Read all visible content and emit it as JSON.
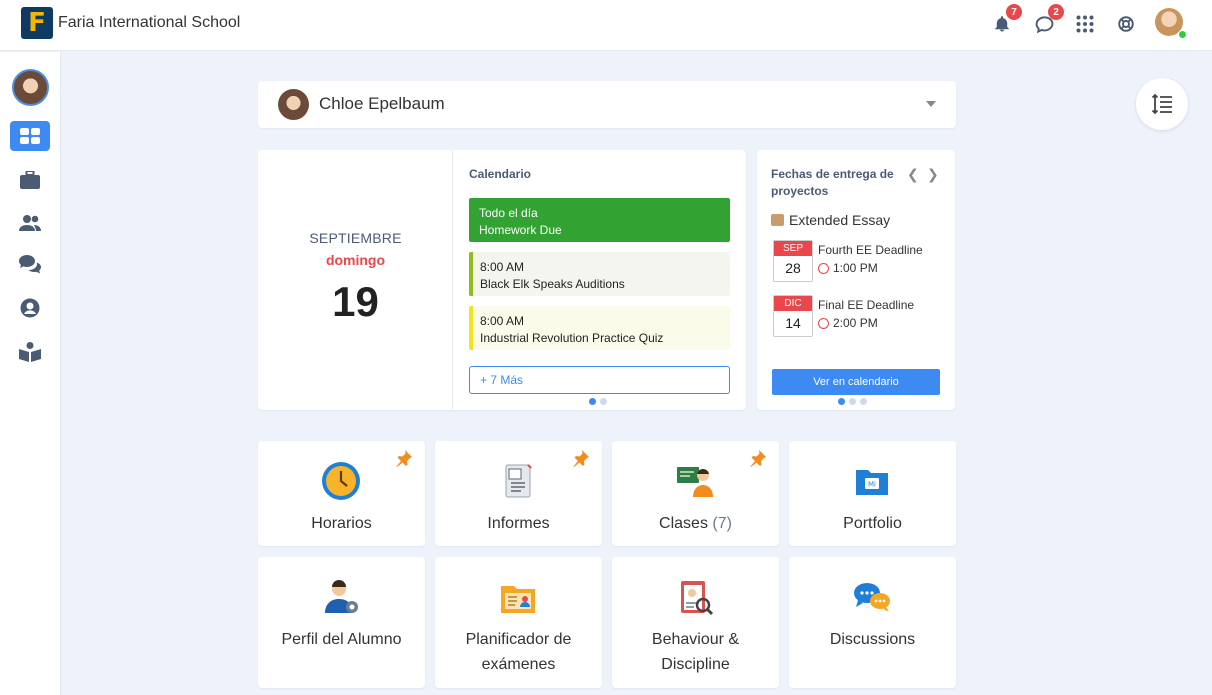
{
  "header": {
    "school_name": "Faria International School",
    "notifications_count": "7",
    "messages_count": "2"
  },
  "sidebar": {
    "items": [
      {
        "icon": "dashboard-icon",
        "active": true
      },
      {
        "icon": "briefcase-icon"
      },
      {
        "icon": "people-icon"
      },
      {
        "icon": "chat-icon"
      },
      {
        "icon": "user-circle-icon"
      },
      {
        "icon": "open-book-icon"
      }
    ]
  },
  "student": {
    "name": "Chloe Epelbaum"
  },
  "date": {
    "month": "SEPTIEMBRE",
    "weekday": "domingo",
    "day": "19"
  },
  "calendar": {
    "title": "Calendario",
    "events": [
      {
        "time": "Todo el día",
        "name": "Homework Due"
      },
      {
        "time": "8:00 AM",
        "name": "Black Elk Speaks Auditions"
      },
      {
        "time": "8:00 AM",
        "name": "Industrial Revolution Practice Quiz"
      }
    ],
    "more": "+ 7 Más"
  },
  "deadlines": {
    "title": "Fechas de entrega de proyectos",
    "project": "Extended Essay",
    "items": [
      {
        "month": "SEP",
        "day": "28",
        "name": "Fourth EE Deadline",
        "time": "1:00 PM"
      },
      {
        "month": "DIC",
        "day": "14",
        "name": "Final EE Deadline",
        "time": "2:00 PM"
      }
    ],
    "button": "Ver en calendario"
  },
  "tiles": [
    {
      "label": "Horarios",
      "pinned": true
    },
    {
      "label": "Informes",
      "pinned": true
    },
    {
      "label": "Clases",
      "count": "(7)",
      "pinned": true
    },
    {
      "label": "Portfolio",
      "pinned": false
    },
    {
      "label": "Perfil del Alumno"
    },
    {
      "label": "Planificador de exámenes"
    },
    {
      "label": "Behaviour & Discipline"
    },
    {
      "label": "Discussions"
    }
  ],
  "colors": {
    "accent": "#3d8bf2",
    "alert": "#e8474b",
    "all_day": "#32a232"
  }
}
